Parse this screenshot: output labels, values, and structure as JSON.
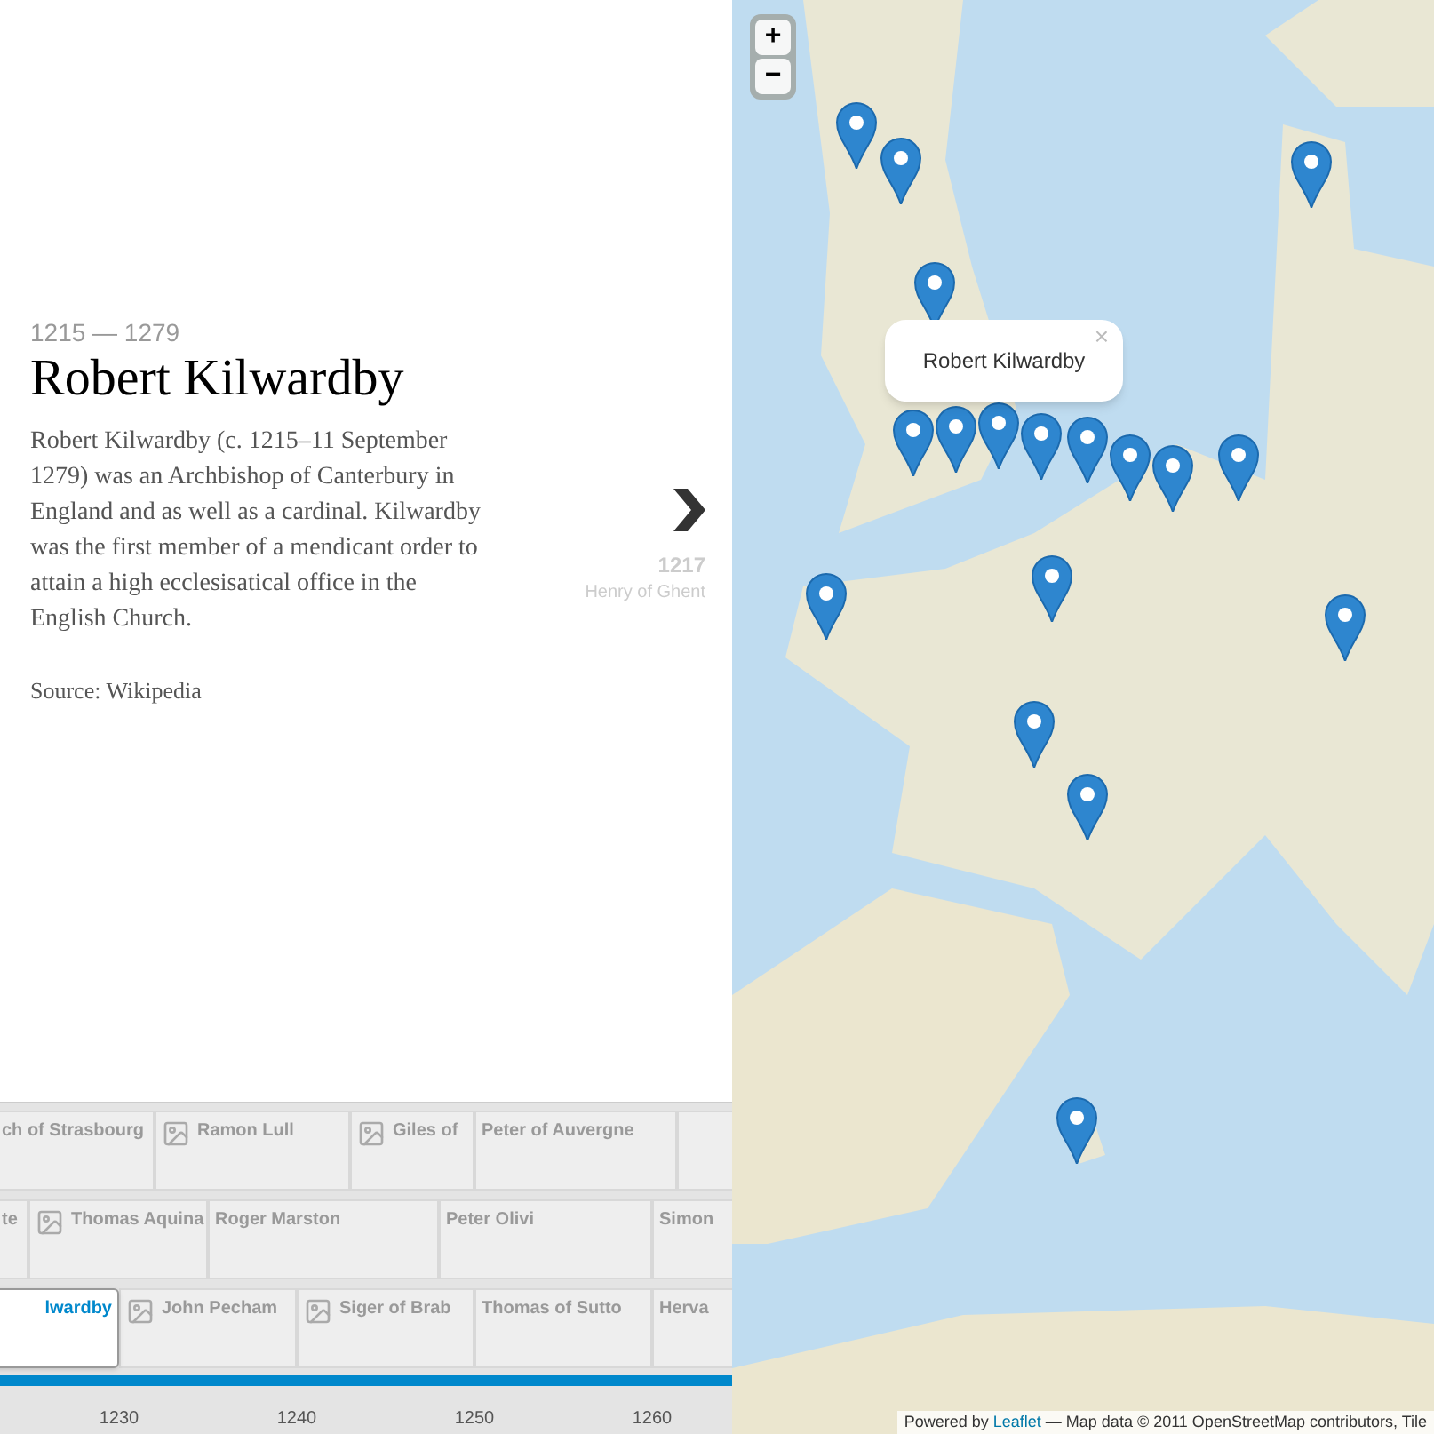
{
  "story": {
    "dates": "1215 — 1279",
    "title": "Robert Kilwardby",
    "body": "Robert Kilwardby (c. 1215–11 September 1279) was an Archbishop of Canterbury in England and as well as a cardinal. Kilwardby was the first member of a mendicant order to attain a high ecclesisatical office in the English Church.",
    "source": "Source: Wikipedia"
  },
  "next": {
    "year": "1217",
    "name": "Henry of Ghent"
  },
  "timeline": {
    "lanes": [
      {
        "cards": [
          {
            "label": "ch of Strasbourg",
            "picture": false,
            "selected": false
          },
          {
            "label": "Ramon Lull",
            "picture": true,
            "selected": false
          },
          {
            "label": "Giles of",
            "picture": true,
            "selected": false
          },
          {
            "label": "Peter of Auvergne",
            "picture": false,
            "selected": false
          },
          {
            "picture": false,
            "selected": false
          }
        ]
      },
      {
        "cards": [
          {
            "label": "te",
            "picture": false,
            "selected": false
          },
          {
            "label": "Thomas Aquina",
            "picture": true,
            "selected": false
          },
          {
            "label": "Roger Marston",
            "picture": false,
            "selected": false
          },
          {
            "label": "Peter Olivi",
            "picture": false,
            "selected": false
          },
          {
            "label": "Simon",
            "picture": false,
            "selected": false
          }
        ]
      },
      {
        "cards": [
          {
            "label": "lwardby",
            "picture": false,
            "selected": true
          },
          {
            "label": "John Pecham",
            "picture": true,
            "selected": false
          },
          {
            "label": "Siger of Brab",
            "picture": true,
            "selected": false
          },
          {
            "label": "Thomas of Sutto",
            "picture": false,
            "selected": false
          },
          {
            "label": "Herva",
            "picture": false,
            "selected": false
          }
        ]
      }
    ],
    "ticks": [
      "1230",
      "1240",
      "1250",
      "1260"
    ]
  },
  "map": {
    "zoom_in": "+",
    "zoom_out": "−",
    "popup": {
      "title": "Robert Kilwardby",
      "close": "×"
    },
    "attribution": {
      "prefix": "Powered by",
      "link": "Leaflet",
      "rest": "— Map data © 2011 OpenStreetMap contributors, Tile"
    }
  }
}
